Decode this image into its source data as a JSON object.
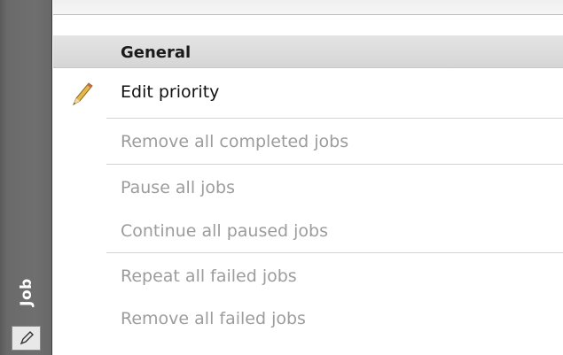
{
  "sidebar": {
    "label": "Job",
    "edit_icon": "pencil-icon"
  },
  "menu": {
    "header": "General",
    "items": [
      {
        "label": "Edit priority",
        "enabled": true,
        "icon": "pencil-icon"
      },
      {
        "label": "Remove all completed jobs",
        "enabled": false
      },
      {
        "label": "Pause all jobs",
        "enabled": false
      },
      {
        "label": "Continue all paused jobs",
        "enabled": false
      },
      {
        "label": "Repeat all failed jobs",
        "enabled": false
      },
      {
        "label": "Remove all failed jobs",
        "enabled": false
      }
    ]
  },
  "colors": {
    "enabled_text": "#111111",
    "disabled_text": "#9c9c9c",
    "sidebar_bg": "#6f6f6f",
    "header_bg": "#dcdcdc"
  }
}
